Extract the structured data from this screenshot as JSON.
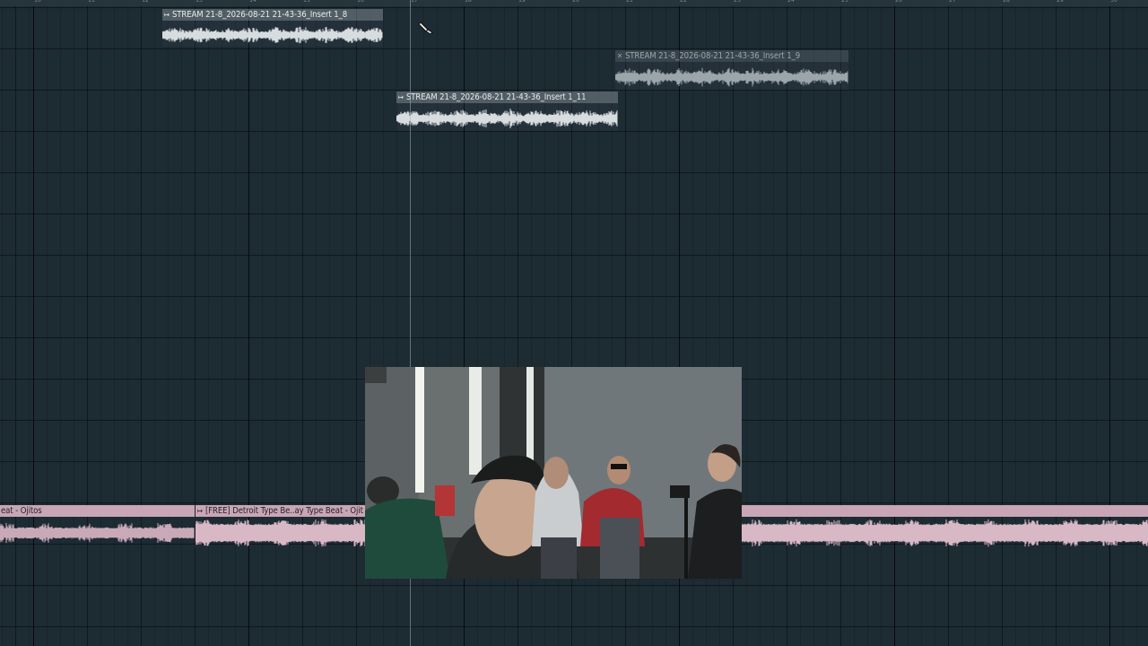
{
  "ruler": {
    "bars": [
      "10",
      "11",
      "12",
      "13",
      "14",
      "15",
      "16",
      "17",
      "18",
      "19",
      "20",
      "21",
      "22",
      "23",
      "24",
      "25",
      "26",
      "27",
      "28",
      "29",
      "30"
    ]
  },
  "clips": {
    "insert_8": {
      "icon": "audio-clip-arrow-icon",
      "title": "STREAM 21-8_2026-08-21 21-43-36_Insert 1_8"
    },
    "insert_9": {
      "icon": "muted-clip-x-icon",
      "title": "STREAM 21-8_2026-08-21 21-43-36_Insert 1_9"
    },
    "insert_11": {
      "icon": "audio-clip-arrow-icon",
      "title": "STREAM 21-8_2026-08-21 21-43-36_Insert 1_11"
    }
  },
  "beat_track": {
    "clip_left_title": "eat - Ojitos",
    "clip_right_title": "[FREE] Detroit Type Be..ay Type Beat - Ojit",
    "color": "#c8a6b6"
  },
  "colors": {
    "background": "#1d2b33",
    "gray_clip_header": "#5b676d",
    "pink_wave": "#d9b8c6"
  }
}
